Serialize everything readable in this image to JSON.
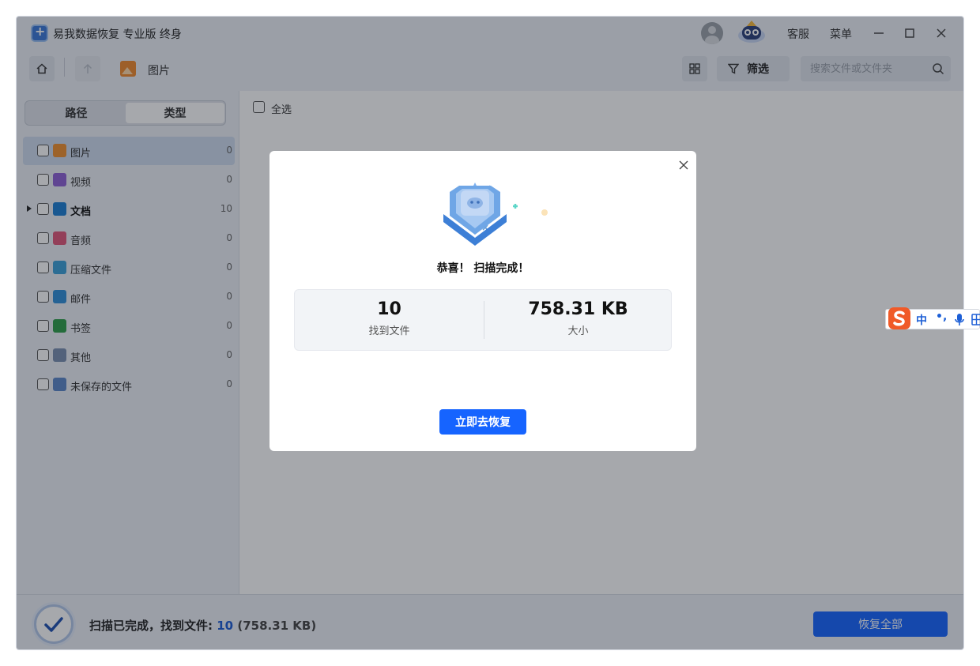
{
  "window": {
    "title": "易我数据恢复 专业版 终身",
    "support": "客服",
    "menu": "菜单"
  },
  "toolbar": {
    "breadcrumb": "图片",
    "filter_label": "筛选",
    "search_placeholder": "搜索文件或文件夹"
  },
  "sidebar": {
    "tabs": [
      {
        "label": "路径",
        "active": false
      },
      {
        "label": "类型",
        "active": true
      }
    ],
    "categories": [
      {
        "label": "图片",
        "count": "0",
        "icon": "image-icon",
        "color": "#f0902e"
      },
      {
        "label": "视频",
        "count": "0",
        "icon": "video-icon",
        "color": "#8f5fd6"
      },
      {
        "label": "文档",
        "count": "10",
        "icon": "document-icon",
        "color": "#1c7fd4"
      },
      {
        "label": "音频",
        "count": "0",
        "icon": "audio-icon",
        "color": "#e0567a"
      },
      {
        "label": "压缩文件",
        "count": "0",
        "icon": "archive-icon",
        "color": "#3aa0d8"
      },
      {
        "label": "邮件",
        "count": "0",
        "icon": "mail-icon",
        "color": "#2f8fd8"
      },
      {
        "label": "书签",
        "count": "0",
        "icon": "bookmark-icon",
        "color": "#2e9e4a"
      },
      {
        "label": "其他",
        "count": "0",
        "icon": "folder-icon",
        "color": "#7a8fb0"
      },
      {
        "label": "未保存的文件",
        "count": "0",
        "icon": "unsaved-file-icon",
        "color": "#5b86c9"
      }
    ]
  },
  "content": {
    "select_all": "全选"
  },
  "status": {
    "prefix": "扫描已完成，找到文件:",
    "count": "10",
    "size": "(758.31 KB)",
    "recover_all": "恢复全部"
  },
  "modal": {
    "title": "恭喜！ 扫描完成！",
    "stats": [
      {
        "value": "10",
        "label": "找到文件"
      },
      {
        "value": "758.31 KB",
        "label": "大小"
      }
    ],
    "action": "立即去恢复"
  },
  "ime": {
    "mode": "中",
    "punct": "•,"
  },
  "colors": {
    "accent": "#1664ff",
    "selected_row": "#cfdcef"
  }
}
